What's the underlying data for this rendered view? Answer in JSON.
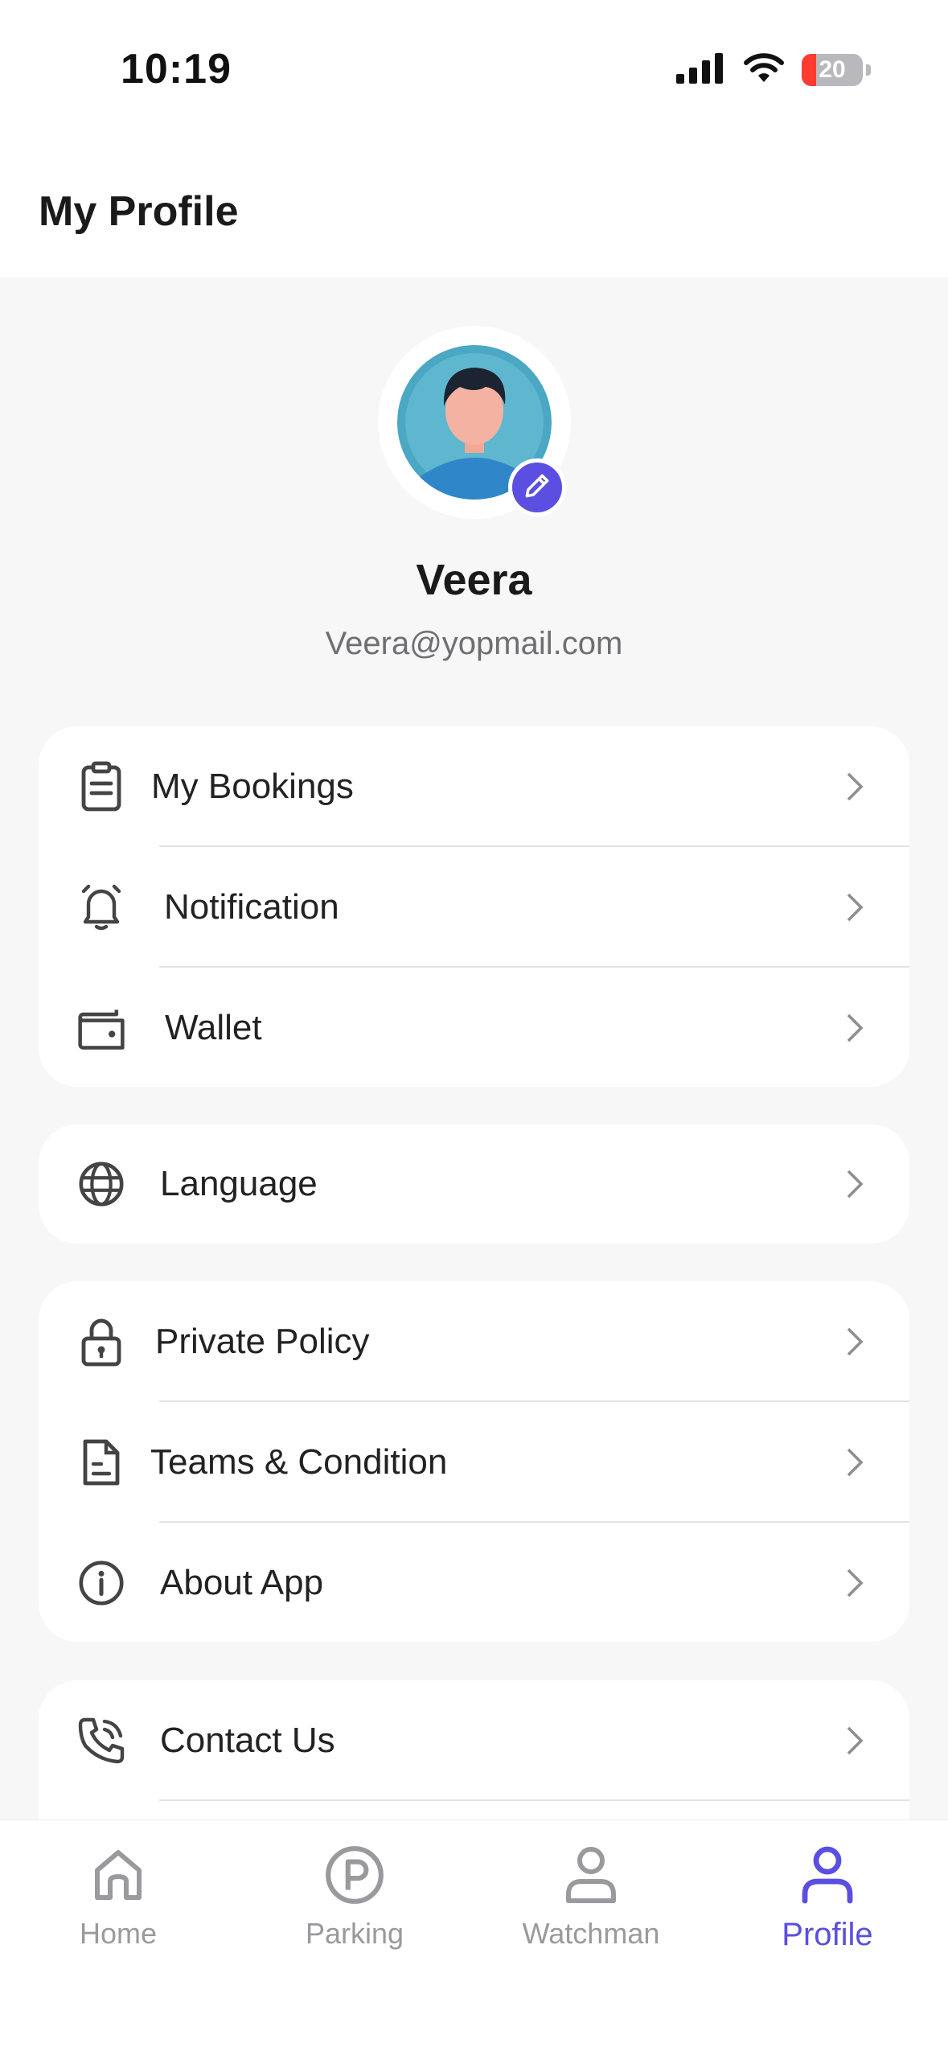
{
  "status_bar": {
    "time": "10:19",
    "battery": "20"
  },
  "header": {
    "title": "My Profile"
  },
  "profile": {
    "name": "Veera",
    "email": "Veera@yopmail.com"
  },
  "menu_groups": [
    [
      {
        "label": "My Bookings",
        "icon": "clipboard-icon"
      },
      {
        "label": "Notification",
        "icon": "bell-icon"
      },
      {
        "label": "Wallet",
        "icon": "wallet-icon"
      }
    ],
    [
      {
        "label": "Language",
        "icon": "globe-icon"
      }
    ],
    [
      {
        "label": "Private Policy",
        "icon": "lock-icon"
      },
      {
        "label": "Teams & Condition",
        "icon": "document-icon"
      },
      {
        "label": "About App",
        "icon": "info-icon"
      }
    ],
    [
      {
        "label": "Contact Us",
        "icon": "phone-icon"
      }
    ]
  ],
  "tabs": [
    {
      "label": "Home",
      "icon": "home-icon",
      "active": false
    },
    {
      "label": "Parking",
      "icon": "parking-icon",
      "active": false
    },
    {
      "label": "Watchman",
      "icon": "person-icon",
      "active": false
    },
    {
      "label": "Profile",
      "icon": "profile-icon",
      "active": true
    }
  ],
  "colors": {
    "accent": "#5a4fe0",
    "inactive": "#9a9a9e",
    "background": "#f7f7f7"
  }
}
